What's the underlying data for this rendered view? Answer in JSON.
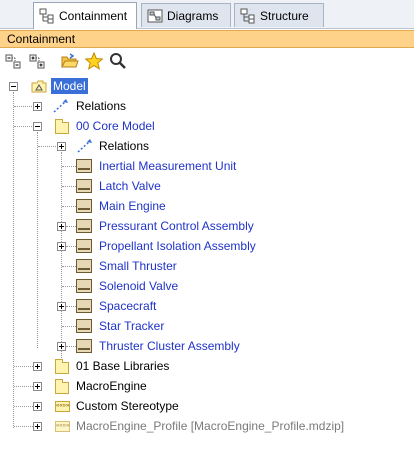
{
  "tabs": [
    {
      "label": "Containment",
      "icon": "containment-tab-icon",
      "active": true
    },
    {
      "label": "Diagrams",
      "icon": "diagrams-tab-icon",
      "active": false
    },
    {
      "label": "Structure",
      "icon": "structure-tab-icon",
      "active": false
    }
  ],
  "panel": {
    "title": "Containment"
  },
  "toolbar": {
    "buttons": [
      "collapse-all-icon",
      "expand-all-icon",
      "open-folder-icon",
      "star-icon",
      "search-icon"
    ]
  },
  "tree": {
    "model": "Model",
    "relations": "Relations",
    "core_model": "00 Core Model",
    "core_relations": "Relations",
    "core_items": [
      "Inertial Measurement Unit",
      "Latch Valve",
      "Main Engine",
      "Pressurant Control Assembly",
      "Propellant Isolation Assembly",
      "Small Thruster",
      "Solenoid Valve",
      "Spacecraft",
      "Star Tracker",
      "Thruster Cluster Assembly"
    ],
    "base_libraries": "01 Base Libraries",
    "macroengine": "MacroEngine",
    "custom_stereotype": "Custom Stereotype",
    "macroengine_profile": "MacroEngine_Profile [MacroEngine_Profile.mdzip]"
  },
  "colors": {
    "selection": "#3a6fd8",
    "element_text": "#2033c8",
    "header_bg": "#ffd28a"
  }
}
